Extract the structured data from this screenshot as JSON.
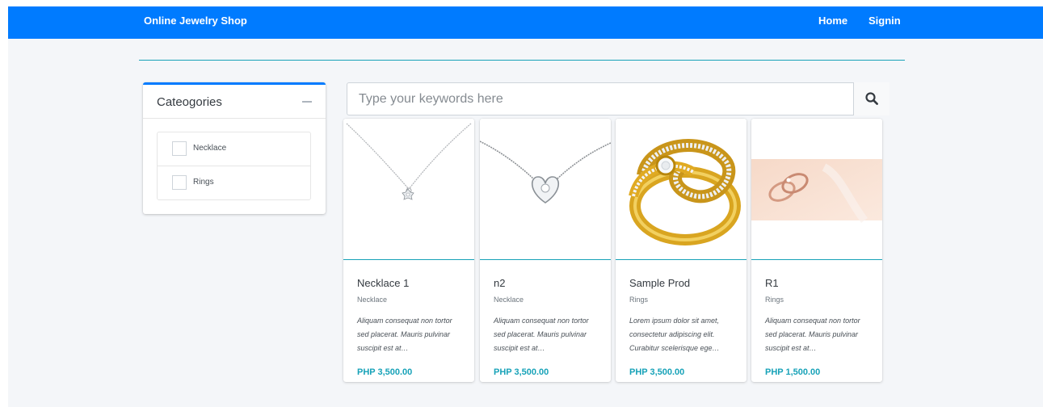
{
  "navbar": {
    "brand": "Online Jewelry Shop",
    "home": "Home",
    "signin": "Signin",
    "color": "#007bff"
  },
  "categories": {
    "title": "Cateogories",
    "collapse_icon": "minus-icon",
    "items": [
      {
        "label": "Necklace",
        "checked": false
      },
      {
        "label": "Rings",
        "checked": false
      }
    ]
  },
  "search": {
    "placeholder": "Type your keywords here",
    "value": "",
    "icon": "search-icon"
  },
  "products": [
    {
      "name": "Necklace 1",
      "category": "Necklace",
      "description": "Aliquam consequat non tortor sed placerat. Mauris pulvinar suscipit est at…",
      "price": "PHP 3,500.00",
      "image": "pendant-necklace-image"
    },
    {
      "name": "n2",
      "category": "Necklace",
      "description": "Aliquam consequat non tortor sed placerat. Mauris pulvinar suscipit est at…",
      "price": "PHP 3,500.00",
      "image": "heart-necklace-image"
    },
    {
      "name": "Sample Prod",
      "category": "Rings",
      "description": "Lorem ipsum dolor sit amet, consectetur adipiscing elit. Curabitur scelerisque ege…",
      "price": "PHP 3,500.00",
      "image": "gold-ring-image"
    },
    {
      "name": "R1",
      "category": "Rings",
      "description": "Aliquam consequat non tortor sed placerat. Mauris pulvinar suscipit est at…",
      "price": "PHP 1,500.00",
      "image": "rose-gold-rings-image"
    }
  ],
  "colors": {
    "accent": "#17a2b8",
    "primary": "#007bff",
    "background": "#f4f6f9"
  }
}
